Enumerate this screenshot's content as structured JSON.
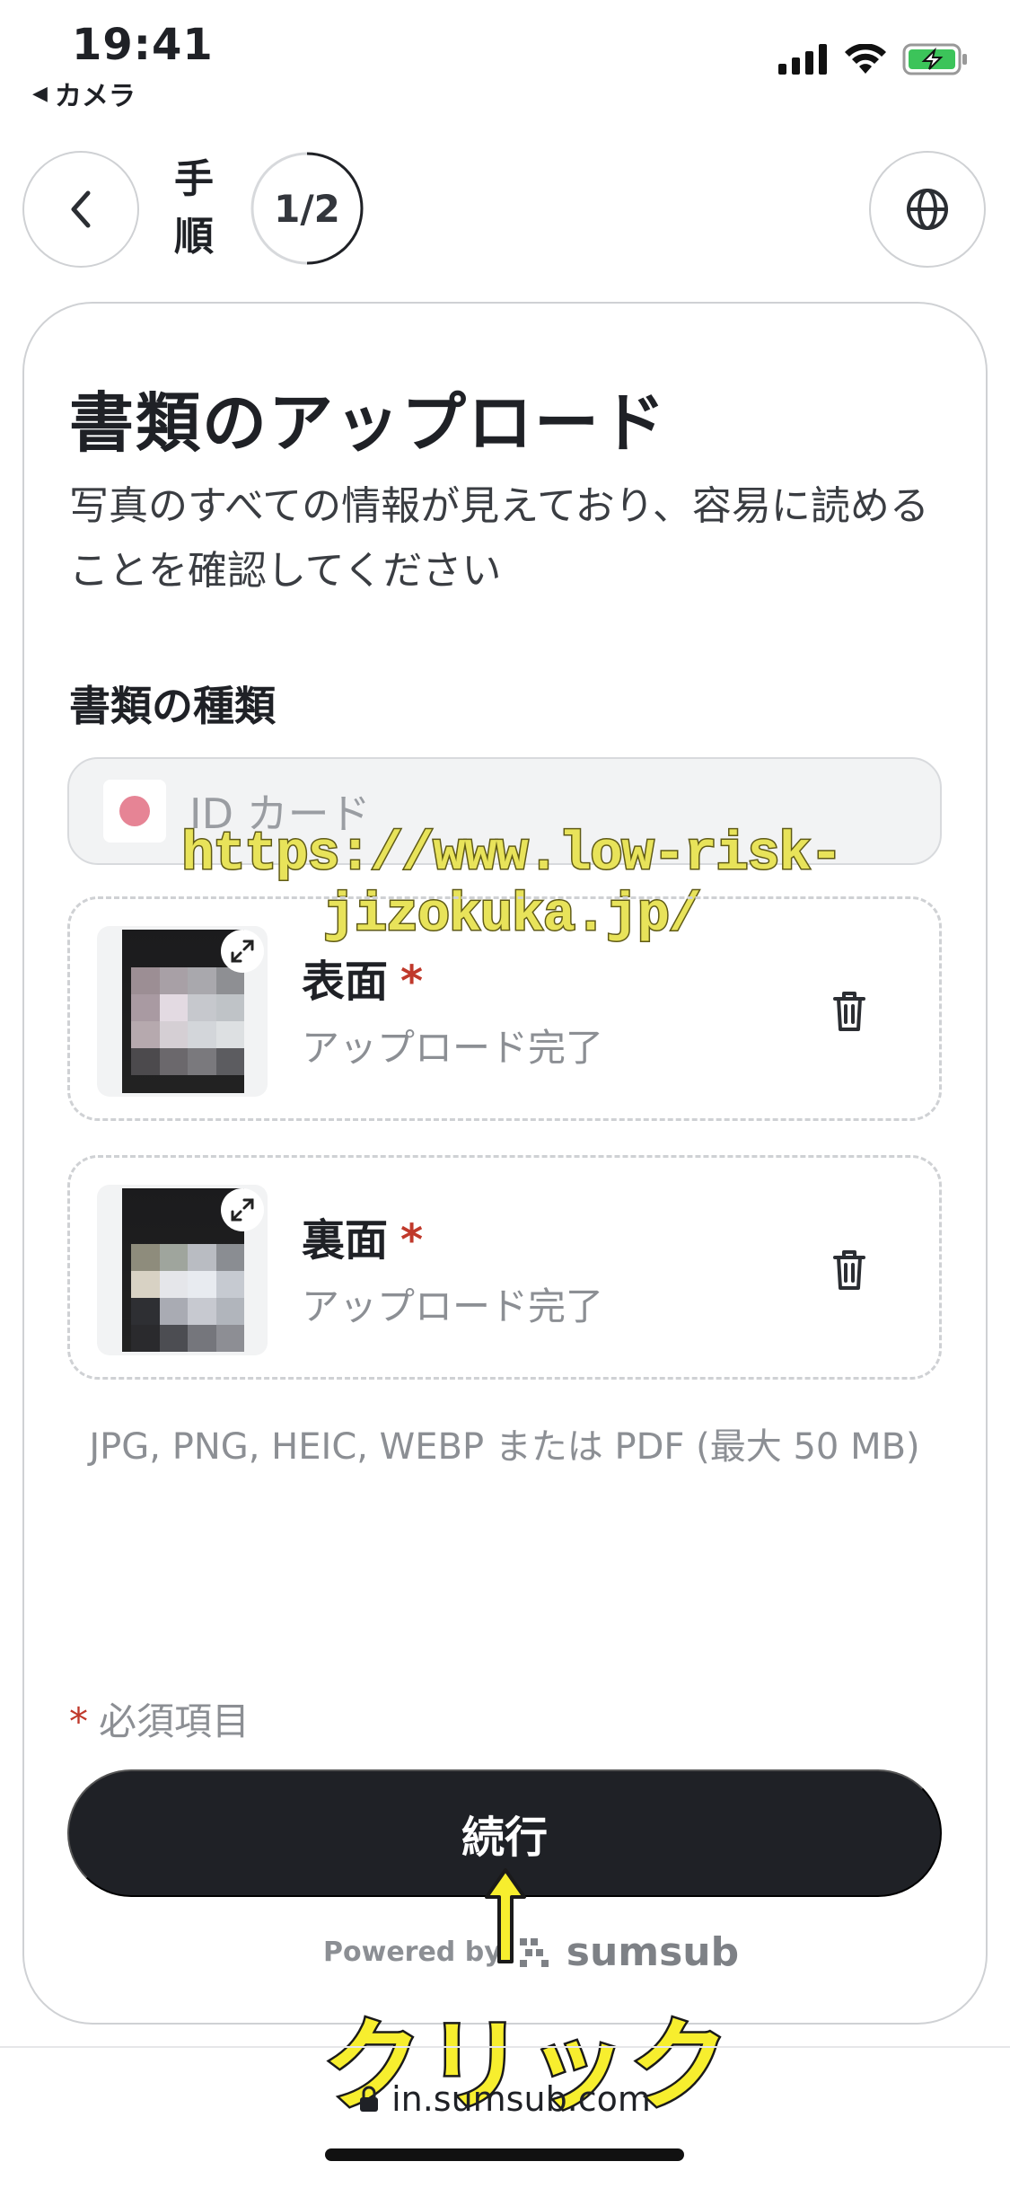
{
  "status_bar": {
    "time": "19:41",
    "back_app": "カメラ"
  },
  "header": {
    "step_label": "手順",
    "step_counter": "1/2",
    "step_progress": 0.5
  },
  "main": {
    "title": "書類のアップロード",
    "description": "写真のすべての情報が見えており、容易に読めることを確認してください",
    "doc_type_label": "書類の種類",
    "doc_type_value": "ID カード",
    "uploads": [
      {
        "name": "表面",
        "required_mark": "*",
        "status": "アップロード完了"
      },
      {
        "name": "裏面",
        "required_mark": "*",
        "status": "アップロード完了"
      }
    ],
    "formats_hint": "JPG, PNG, HEIC, WEBP または PDF (最大 50 MB)",
    "required_note_mark": "*",
    "required_note": "必須項目",
    "continue_label": "続行"
  },
  "footer": {
    "powered_by": "Powered by",
    "brand": "sumsub",
    "url": "in.sumsub.com"
  },
  "annotations": {
    "watermark": "https://www.low-risk-jizokuka.jp/",
    "click_label": "クリック"
  },
  "colors": {
    "primary_button": "#1f2126",
    "required": "#c0392b",
    "muted_text": "#8c8f94",
    "annotation_yellow": "#f7ee2e"
  }
}
